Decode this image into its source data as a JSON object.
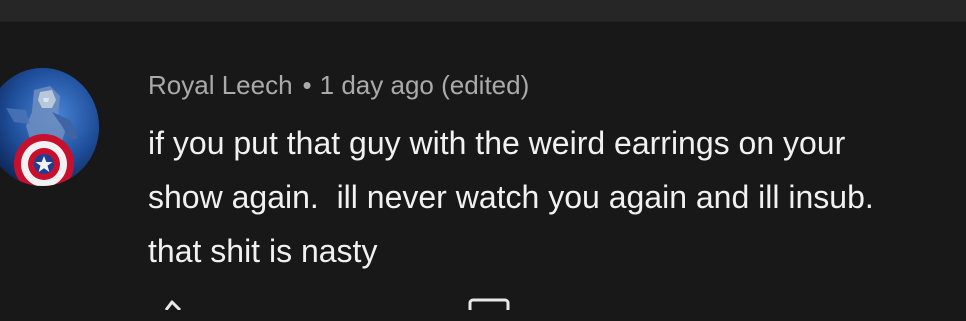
{
  "comment": {
    "author": "Royal Leech",
    "separator": "•",
    "time": "1 day ago (edited)",
    "text": "if you put that guy with the weird earrings on your\nshow again.  ill never watch you again and ill insub.\nthat shit is nasty"
  },
  "icons": {
    "like": "thumbs-up-icon",
    "reply": "reply-icon"
  },
  "colors": {
    "background": "#181818",
    "top_bar": "#262626",
    "author_text": "#aaaaaa",
    "body_text": "#f1f1f1"
  }
}
